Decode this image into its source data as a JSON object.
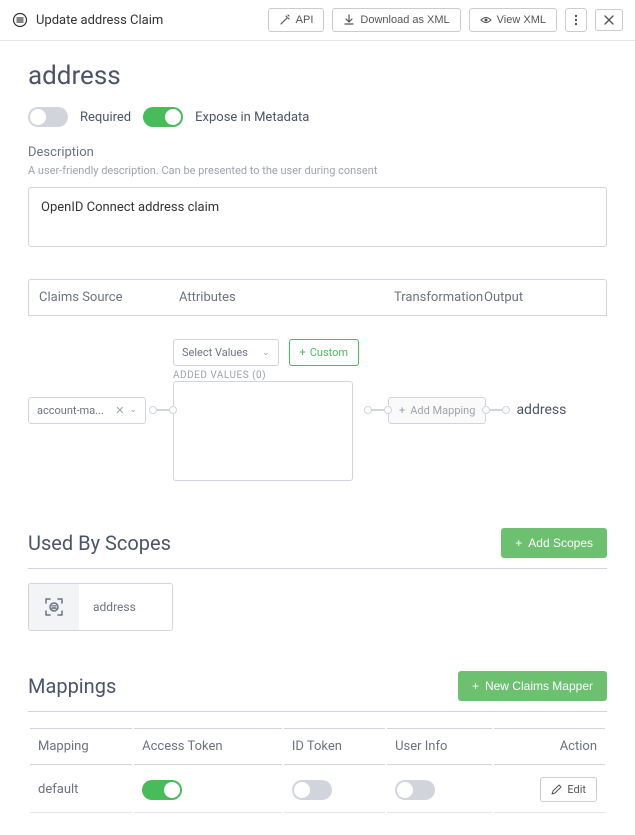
{
  "header": {
    "title": "Update address Claim",
    "api": "API",
    "download": "Download as XML",
    "view": "View XML"
  },
  "page": {
    "title": "address",
    "required_label": "Required",
    "expose_label": "Expose in Metadata",
    "description_label": "Description",
    "description_help": "A user-friendly description. Can be presented to the user during consent",
    "description_value": "OpenID Connect address claim"
  },
  "mapping": {
    "headers": {
      "source": "Claims Source",
      "attributes": "Attributes",
      "transformation": "Transformation",
      "output": "Output"
    },
    "source_chip": "account-ma...",
    "select_values": "Select Values",
    "custom": "Custom",
    "added_values": "ADDED VALUES (0)",
    "add_mapping": "Add Mapping",
    "output": "address"
  },
  "scopes": {
    "title": "Used By Scopes",
    "add": "Add Scopes",
    "item": "address"
  },
  "mappings": {
    "title": "Mappings",
    "new": "New Claims Mapper",
    "cols": {
      "mapping": "Mapping",
      "access": "Access Token",
      "id": "ID Token",
      "userinfo": "User Info",
      "action": "Action"
    },
    "row": {
      "name": "default",
      "edit": "Edit"
    }
  }
}
